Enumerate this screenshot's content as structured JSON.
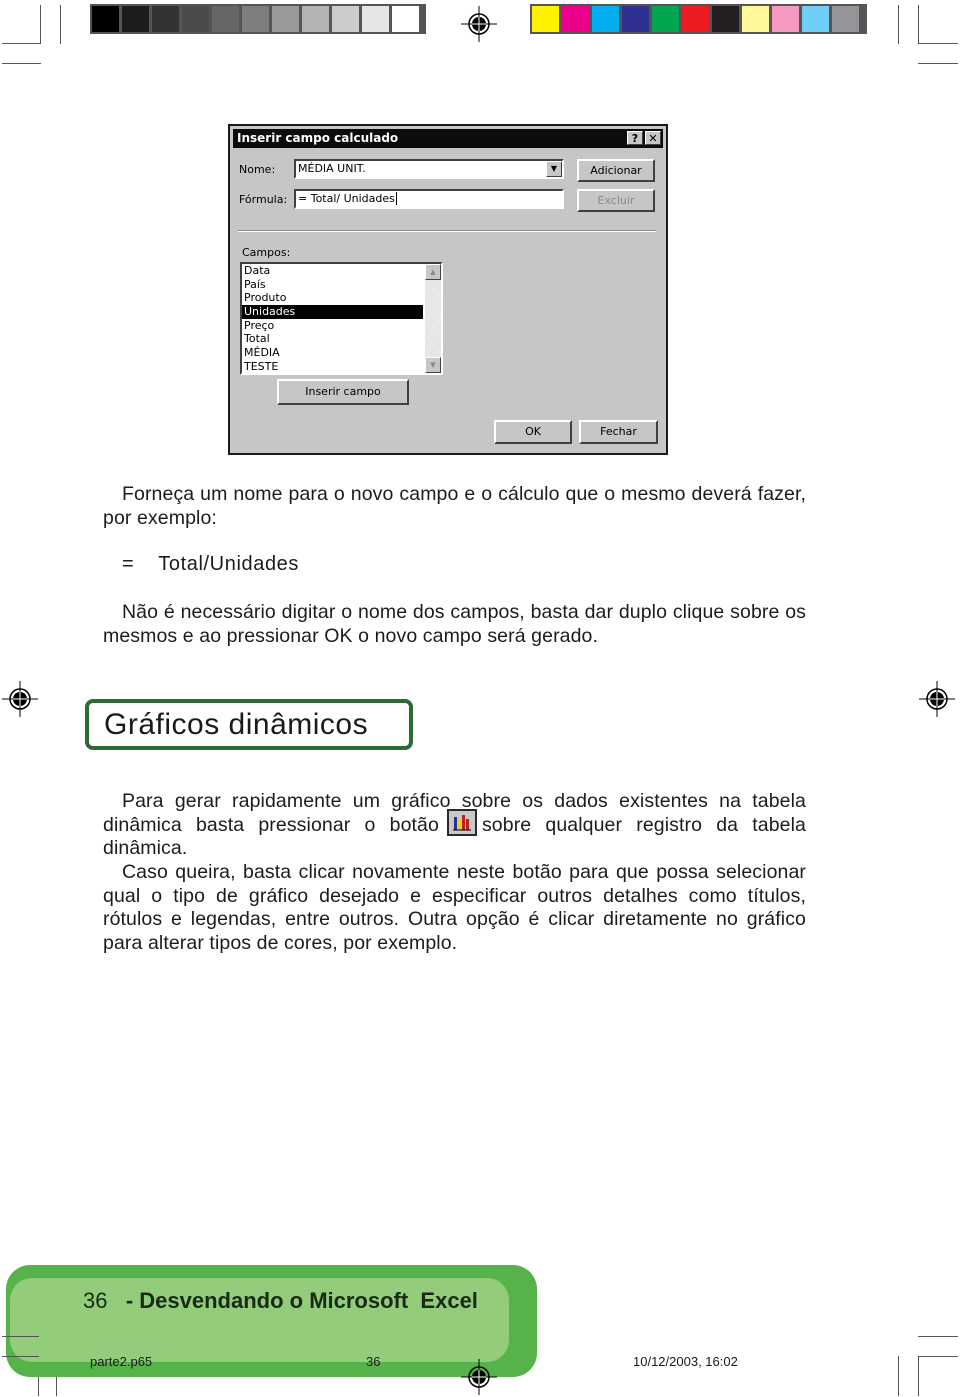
{
  "print_marks": {
    "gray_swatches": [
      "#000000",
      "#1c1c1c",
      "#333333",
      "#4a4a4a",
      "#666666",
      "#7e7e7e",
      "#999999",
      "#b3b3b3",
      "#cccccc",
      "#e6e6e6",
      "#ffffff"
    ],
    "color_swatches": [
      "#fff200",
      "#ec008c",
      "#00aeef",
      "#2e3192",
      "#00a651",
      "#ed1c24",
      "#231f20",
      "#fff799",
      "#f49ac1",
      "#6dcff6",
      "#939598"
    ]
  },
  "dialog": {
    "title": "Inserir campo calculado",
    "help_button": "?",
    "close_button": "✕",
    "nome_label": "Nome:",
    "nome_value": "MÉDIA UNIT.",
    "formula_label": "Fórmula:",
    "formula_value": "= Total/ Unidades",
    "add_button": "Adicionar",
    "delete_button": "Excluir",
    "fields_label": "Campos:",
    "fields": [
      "Data",
      "País",
      "Produto",
      "Unidades",
      "Preço",
      "Total",
      "MÉDIA",
      "TESTE"
    ],
    "selected_field": "Unidades",
    "insert_field_button": "Inserir campo",
    "ok_button": "OK",
    "close_label": "Fechar"
  },
  "content": {
    "para1": "Forneça um nome para o novo campo e o cálculo que o mesmo deverá fazer, por exemplo:",
    "formula_eq": "=",
    "formula_text": "Total/Unidades",
    "para2": "Não é necessário digitar o nome dos campos, basta dar duplo clique sobre os mesmos e ao pressionar OK o novo campo será gerado.",
    "section_title": "Gráficos dinâmicos",
    "para3_before": "Para gerar rapidamente um gráfico sobre os dados existentes na tabela dinâmica basta pressionar o botão",
    "para3_after": "sobre qualquer registro da tabela dinâmica.",
    "para4": "Caso queira, basta clicar novamente neste botão para que possa selecionar qual o tipo de gráfico desejado e especificar outros detalhes como títulos, rótulos e legendas, entre outros. Outra opção é clicar diretamente no gráfico para alterar tipos de cores, por exemplo."
  },
  "footer": {
    "page_number": "36",
    "separator": "-",
    "book_title": "Desvendando o Microsoft  Excel",
    "slug_file": "parte2.p65",
    "slug_page": "36",
    "slug_datetime": "10/12/2003, 16:02",
    "colors": {
      "outer": "#56b34a",
      "inner": "#93cc7a"
    }
  }
}
